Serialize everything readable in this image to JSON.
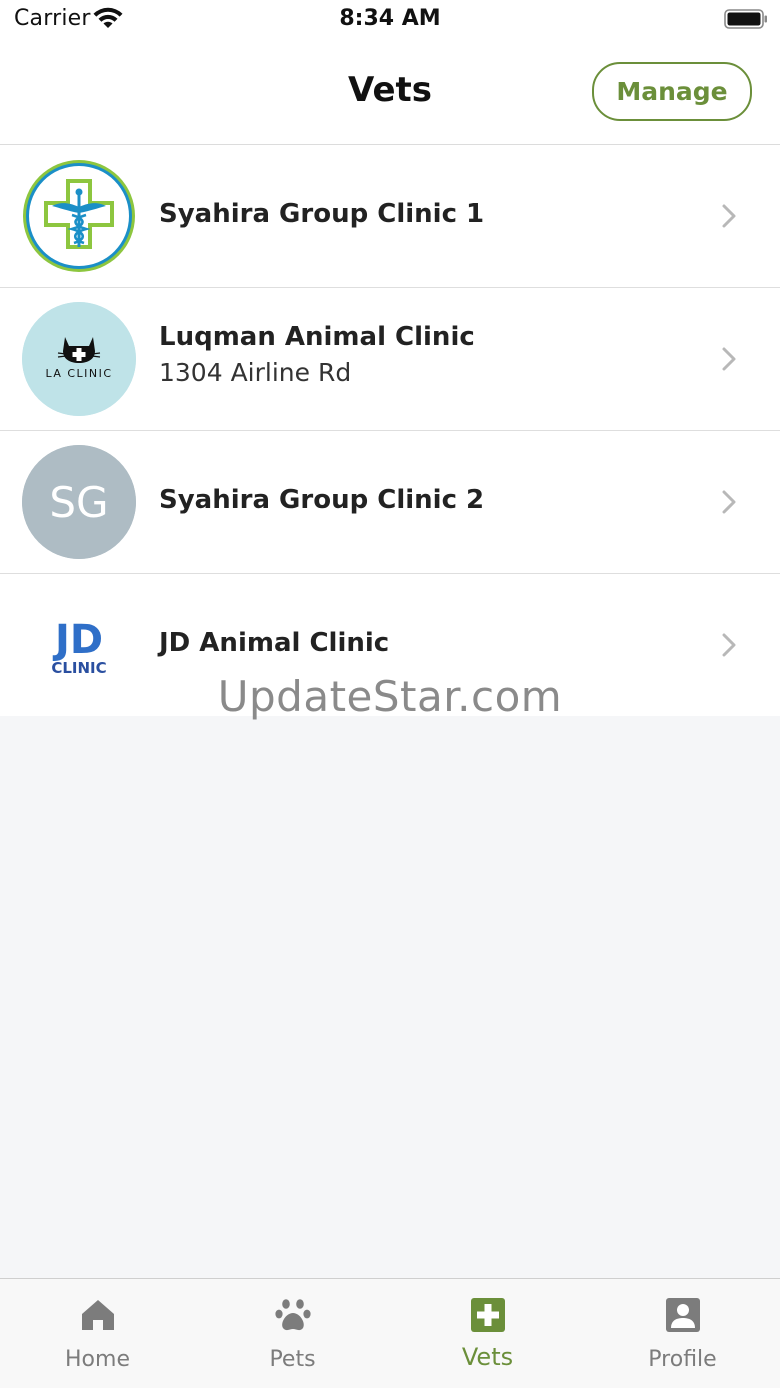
{
  "status_bar": {
    "carrier": "Carrier",
    "time": "8:34 AM"
  },
  "header": {
    "title": "Vets",
    "manage_label": "Manage"
  },
  "vets": [
    {
      "name": "Syahira Group Clinic 1",
      "address": "",
      "avatar_icon": "caduceus-cross-logo"
    },
    {
      "name": "Luqman Animal Clinic",
      "address": "1304 Airline Rd",
      "avatar_icon": "cat-la-clinic-logo",
      "logo_text": "LA CLINIC"
    },
    {
      "name": "Syahira Group Clinic 2",
      "address": "",
      "avatar_icon": "initials-avatar",
      "initials": "SG"
    },
    {
      "name": "JD Animal Clinic",
      "address": "",
      "avatar_icon": "jd-clinic-logo",
      "logo_text": "JD CLINIC"
    }
  ],
  "watermark": "UpdateStar.com",
  "tabs": [
    {
      "label": "Home",
      "icon": "home-icon",
      "active": false
    },
    {
      "label": "Pets",
      "icon": "paw-icon",
      "active": false
    },
    {
      "label": "Vets",
      "icon": "medical-cross-icon",
      "active": true
    },
    {
      "label": "Profile",
      "icon": "profile-icon",
      "active": false
    }
  ],
  "colors": {
    "accent": "#6b8f3a",
    "inactive_tab": "#7c7c7c",
    "background": "#f5f6f8",
    "initials_avatar": "#aebcc4",
    "la_clinic_avatar": "#bfe3e8",
    "jd_logo_blue": "#2f6fc8"
  }
}
